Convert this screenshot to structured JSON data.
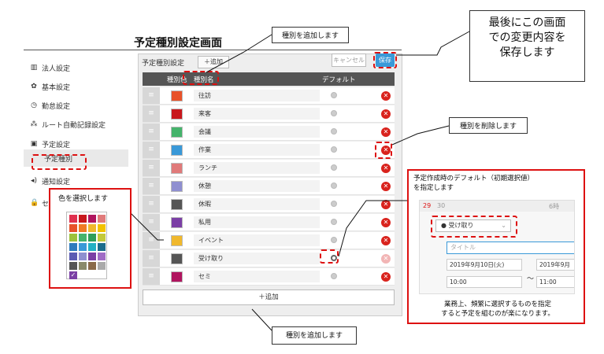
{
  "page_title": "予定種別設定画面",
  "big_callout": [
    "最後にこの画面",
    "での変更内容を",
    "保存します"
  ],
  "callouts": {
    "add_type_top": "種別を追加します",
    "delete_type": "種別を削除します",
    "add_type_bottom": "種別を追加します",
    "select_color": "色を選択します",
    "default_line1": "予定作成時のデフォルト（初期選択値）",
    "default_line2": "を指定します",
    "tip_line1": "業務上、頻繁に選択するものを指定",
    "tip_line2": "すると予定を組むのが楽になります。"
  },
  "sidebar": {
    "items": [
      {
        "label": "法人設定",
        "icon": "▥",
        "icon_name": "building-icon"
      },
      {
        "label": "基本設定",
        "icon": "✿",
        "icon_name": "gear-icon"
      },
      {
        "label": "勤怠設定",
        "icon": "◷",
        "icon_name": "clock-icon"
      },
      {
        "label": "ルート自動記録設定",
        "icon": "⁂",
        "icon_name": "footprint-icon"
      },
      {
        "label": "予定設定",
        "icon": "▣",
        "icon_name": "calendar-icon"
      },
      {
        "label": "予定種別",
        "icon": "",
        "icon_name": ""
      },
      {
        "label": "通知設定",
        "icon": "◂)",
        "icon_name": "speaker-icon"
      },
      {
        "label": "セ",
        "icon": "🔒",
        "icon_name": "lock-icon"
      }
    ]
  },
  "header": {
    "label": "予定種別設定",
    "add_button": "＋追加",
    "cancel_button": "キャンセル",
    "save_button": "保存"
  },
  "table": {
    "columns": [
      "種別色",
      "種別名",
      "デフォルト"
    ],
    "rows": [
      {
        "color": "#e8522a",
        "name": "往訪",
        "default": false
      },
      {
        "color": "#c8171c",
        "name": "来客",
        "default": false
      },
      {
        "color": "#45b36b",
        "name": "会議",
        "default": false
      },
      {
        "color": "#3a99d8",
        "name": "作業",
        "default": false
      },
      {
        "color": "#e07a7a",
        "name": "ランチ",
        "default": false
      },
      {
        "color": "#8f8fd0",
        "name": "休憩",
        "default": false
      },
      {
        "color": "#555555",
        "name": "休暇",
        "default": false
      },
      {
        "color": "#7b3fa5",
        "name": "私用",
        "default": false
      },
      {
        "color": "#f0b82d",
        "name": "イベント",
        "default": false
      },
      {
        "color": "#555555",
        "name": "受け取り",
        "default": true
      },
      {
        "color": "#b0155f",
        "name": "セミ",
        "default": false
      }
    ],
    "add_button": "＋追加"
  },
  "palette": [
    "#e0304e",
    "#c8171c",
    "#b0155f",
    "#e07a7a",
    "#e8522a",
    "#f07b24",
    "#f0b82d",
    "#f2c200",
    "#9cc23b",
    "#45b36b",
    "#2f9e5a",
    "#c3c93a",
    "#2e7bbd",
    "#3a99d8",
    "#24b0c4",
    "#1c6d8c",
    "#5b5bb3",
    "#8f8fd0",
    "#7b3fa5",
    "#a06cc5",
    "#555555",
    "#8a8a6a",
    "#8a6a4a",
    "#aaaaaa",
    "#7b3fa5"
  ],
  "preview": {
    "cal_numbers": [
      "29",
      "30"
    ],
    "type_value": "受け取り",
    "title_placeholder": "タイトル",
    "start_date": "2019年9月10日(火)",
    "end_date": "2019年9月",
    "start_time": "10:00",
    "end_time": "11:00",
    "tilde": "～",
    "time_label": "6時"
  }
}
